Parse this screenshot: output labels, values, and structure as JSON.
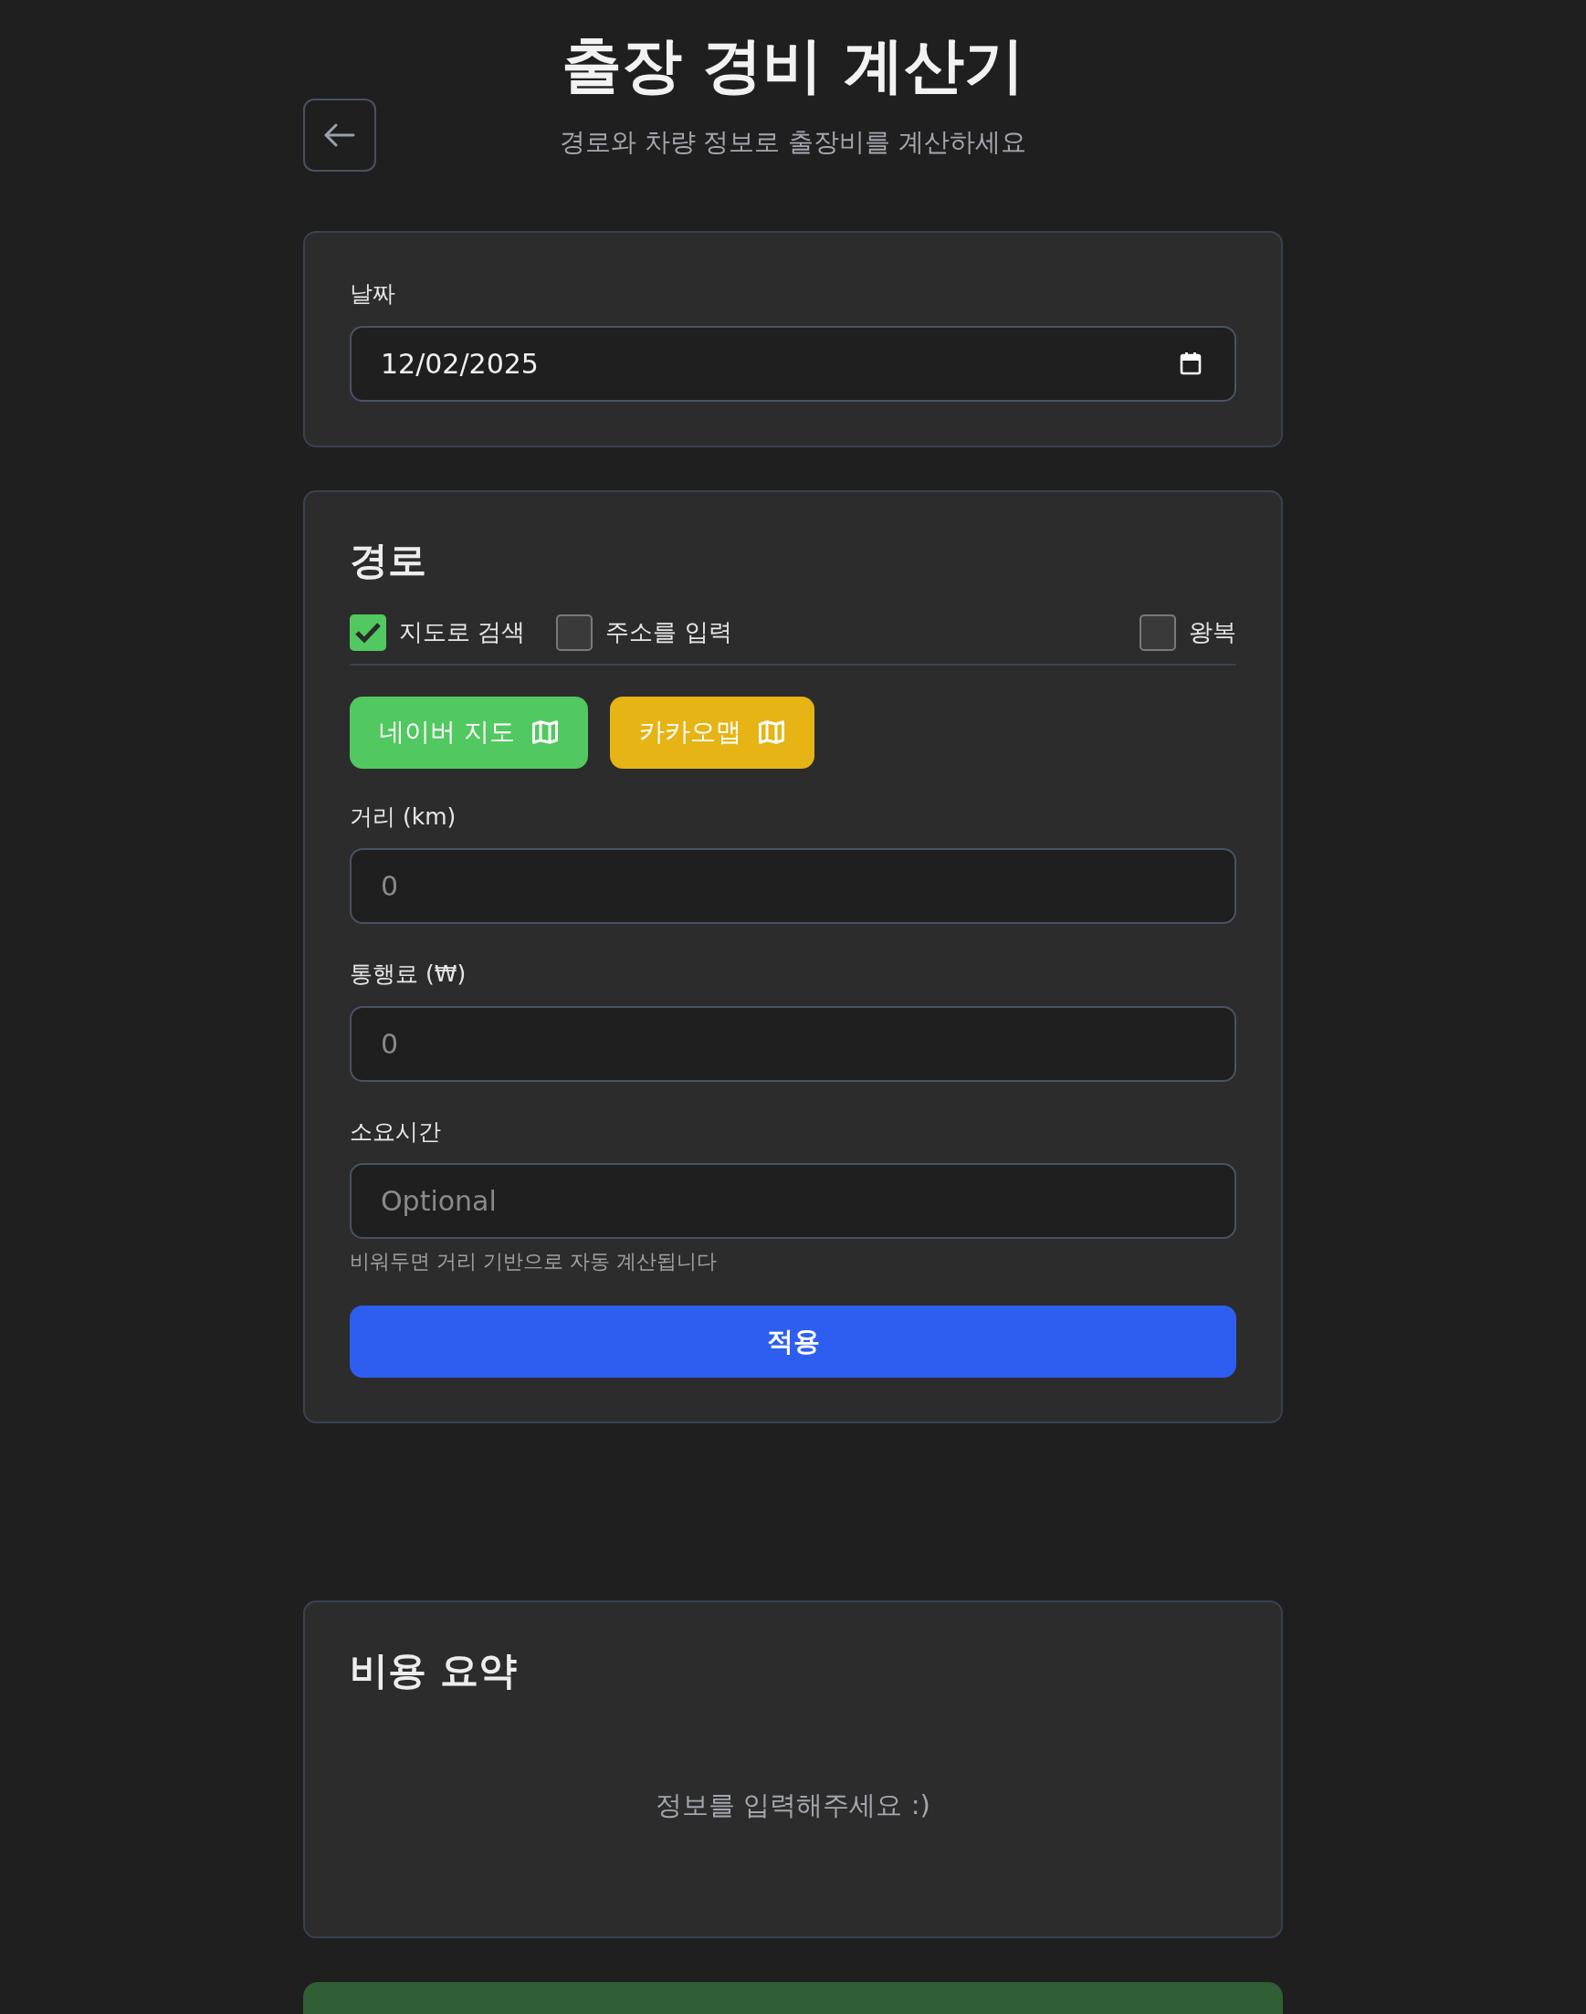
{
  "header": {
    "title": "출장 경비 계산기",
    "subtitle": "경로와 차량 정보로 출장비를 계산하세요"
  },
  "date_card": {
    "label": "날짜",
    "value": "12/02/2025"
  },
  "route_card": {
    "heading": "경로",
    "options": [
      {
        "label": "지도로 검색",
        "checked": true
      },
      {
        "label": "주소를 입력",
        "checked": false
      }
    ],
    "round_trip": {
      "label": "왕복",
      "checked": false
    },
    "map_buttons": [
      {
        "label": "네이버 지도",
        "color": "#52c860"
      },
      {
        "label": "카카오맵",
        "color": "#e6b414"
      }
    ],
    "fields": [
      {
        "label": "거리 (km)",
        "placeholder": "0"
      },
      {
        "label": "통행료 (₩)",
        "placeholder": "0"
      },
      {
        "label": "소요시간",
        "placeholder": "Optional",
        "help": "비워두면 거리 기반으로 자동 계산됩니다"
      }
    ],
    "apply_button": "적용"
  },
  "summary": {
    "heading": "비용 요약",
    "empty_message": "정보를 입력해주세요 :)"
  }
}
